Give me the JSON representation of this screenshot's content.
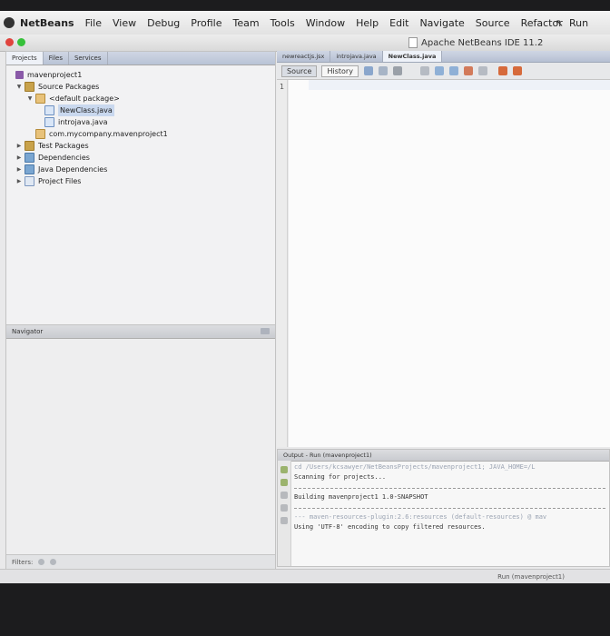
{
  "menubar": {
    "app": "NetBeans",
    "items": [
      "File",
      "View",
      "Debug",
      "Profile",
      "Team",
      "Tools",
      "Window",
      "Help",
      "Edit",
      "Navigate",
      "Source",
      "Refactor",
      "Run"
    ]
  },
  "window": {
    "title": "Apache NetBeans IDE 11.2"
  },
  "projects": {
    "tabs": [
      "Projects",
      "Files",
      "Services"
    ],
    "tree": [
      {
        "label": "mavenproject1",
        "icon": "project-icon"
      },
      {
        "label": "Source Packages",
        "icon": "source-packages-icon"
      },
      {
        "label": "<default package>",
        "icon": "package-icon"
      },
      {
        "label": "NewClass.java",
        "icon": "java-file-icon"
      },
      {
        "label": "introjava.java",
        "icon": "java-file-icon"
      },
      {
        "label": "com.mycompany.mavenproject1",
        "icon": "package-icon"
      },
      {
        "label": "Test Packages",
        "icon": "test-packages-icon"
      },
      {
        "label": "Dependencies",
        "icon": "dependencies-icon"
      },
      {
        "label": "Java Dependencies",
        "icon": "java-dependencies-icon"
      },
      {
        "label": "Project Files",
        "icon": "project-files-icon"
      }
    ]
  },
  "navigator": {
    "title": "Navigator",
    "filters_label": "Filters:"
  },
  "editor": {
    "tabs": [
      "newreactjs.jsx",
      "introjava.java",
      "NewClass.java"
    ],
    "source_label": "Source",
    "history_label": "History",
    "line_numbers": [
      "1"
    ]
  },
  "output": {
    "tab_label": "Output - Run (mavenproject1)",
    "lines": [
      "cd /Users/kcsawyer/NetBeansProjects/mavenproject1; JAVA_HOME=/L",
      "Scanning for projects...",
      "Building mavenproject1 1.0-SNAPSHOT",
      "--- maven-resources-plugin:2.6:resources (default-resources) @ mav",
      "Using 'UTF-8' encoding to copy filtered resources."
    ]
  },
  "status": {
    "task": "Run (mavenproject1)"
  },
  "colors": {
    "selection": "#c9d8ee",
    "tab_gradient_top": "#cfd6e4",
    "editor_bg": "#fbfbfb"
  }
}
